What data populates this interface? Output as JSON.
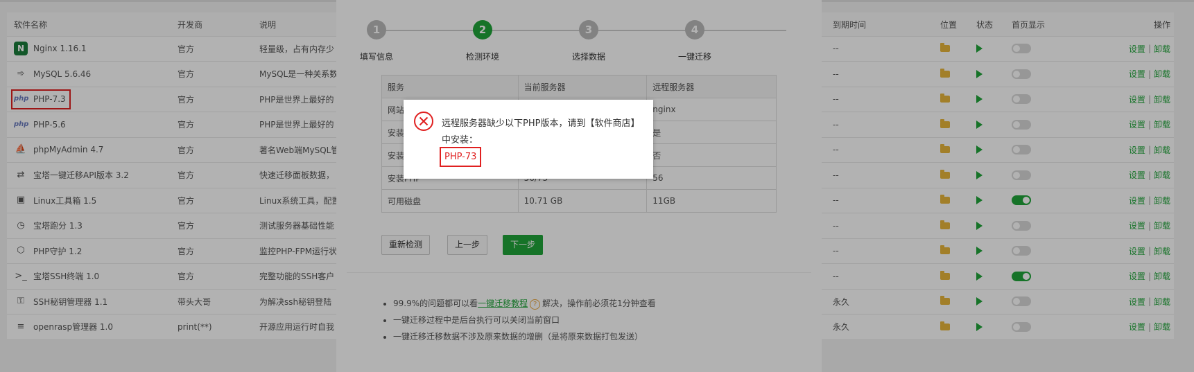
{
  "table": {
    "headers": {
      "name": "软件名称",
      "developer": "开发商",
      "description": "说明",
      "expire": "到期时间",
      "location": "位置",
      "status": "状态",
      "homepage": "首页显示",
      "ops": "操作"
    },
    "rows": [
      {
        "icon": "nginx-icon",
        "name": "Nginx 1.16.1",
        "developer": "官方",
        "description": "轻量级，占有内存少",
        "expire": "--",
        "home_on": false
      },
      {
        "icon": "mysql-icon",
        "name": "MySQL 5.6.46",
        "developer": "官方",
        "description": "MySQL是一种关系数",
        "expire": "--",
        "home_on": false
      },
      {
        "icon": "php-icon",
        "name": "PHP-7.3",
        "developer": "官方",
        "description": "PHP是世界上最好的",
        "expire": "--",
        "home_on": false
      },
      {
        "icon": "php-icon",
        "name": "PHP-5.6",
        "developer": "官方",
        "description": "PHP是世界上最好的",
        "expire": "--",
        "home_on": false
      },
      {
        "icon": "phpmyadmin-icon",
        "name": "phpMyAdmin 4.7",
        "developer": "官方",
        "description": "著名Web端MySQL管",
        "expire": "--",
        "home_on": false
      },
      {
        "icon": "migrate-api-icon",
        "name": "宝塔一键迁移API版本 3.2",
        "developer": "官方",
        "description": "快速迁移面板数据，",
        "expire": "--",
        "home_on": false
      },
      {
        "icon": "toolbox-icon",
        "name": "Linux工具箱 1.5",
        "developer": "官方",
        "description": "Linux系统工具，配置",
        "expire": "--",
        "home_on": true
      },
      {
        "icon": "benchmark-icon",
        "name": "宝塔跑分 1.3",
        "developer": "官方",
        "description": "测试服务器基础性能",
        "expire": "--",
        "home_on": false
      },
      {
        "icon": "php-guard-icon",
        "name": "PHP守护 1.2",
        "developer": "官方",
        "description": "监控PHP-FPM运行状",
        "expire": "--",
        "home_on": false
      },
      {
        "icon": "terminal-icon",
        "name": "宝塔SSH终端 1.0",
        "developer": "官方",
        "description": "完整功能的SSH客户",
        "expire": "--",
        "home_on": true
      },
      {
        "icon": "key-icon",
        "name": "SSH秘钥管理器 1.1",
        "developer": "带头大哥",
        "description": "为解决ssh秘钥登陆",
        "expire": "永久",
        "home_on": false
      },
      {
        "icon": "openrasp-icon",
        "name": "openrasp管理器 1.0",
        "developer": "print(**)",
        "description": "开源应用运行时自我",
        "expire": "永久",
        "home_on": false
      }
    ],
    "ops": {
      "settings": "设置",
      "separator": "|",
      "uninstall": "卸载"
    }
  },
  "dialog": {
    "steps": [
      {
        "num": "1",
        "label": "填写信息",
        "active": false
      },
      {
        "num": "2",
        "label": "检测环境",
        "active": true
      },
      {
        "num": "3",
        "label": "选择数据",
        "active": false
      },
      {
        "num": "4",
        "label": "一键迁移",
        "active": false
      }
    ],
    "env_table": [
      [
        "服务",
        "当前服务器",
        "远程服务器"
      ],
      [
        "网站",
        "",
        "nginx"
      ],
      [
        "安装",
        "",
        "是"
      ],
      [
        "安装",
        "",
        "否"
      ],
      [
        "安装PHP",
        "56/73",
        "56"
      ],
      [
        "可用磁盘",
        "10.71 GB",
        "11GB"
      ]
    ],
    "buttons": {
      "recheck": "重新检测",
      "prev": "上一步",
      "next": "下一步"
    },
    "tips": {
      "tip1_pre": "99.9%的问题都可以看",
      "tip1_link": "一键迁移教程",
      "tip1_q": "?",
      "tip1_post": "解决，操作前必须花1分钟查看",
      "tip2": "一键迁移过程中是后台执行可以关闭当前窗口",
      "tip3": "一键迁移迁移数据不涉及原来数据的增删（是将原来数据打包发送）"
    }
  },
  "popup": {
    "message": "远程服务器缺少以下PHP版本，请到【软件商店】中安装：",
    "version": "PHP-73",
    "icon": "error-circle-icon"
  },
  "colors": {
    "accent": "#20a53a",
    "error": "#e02020"
  }
}
